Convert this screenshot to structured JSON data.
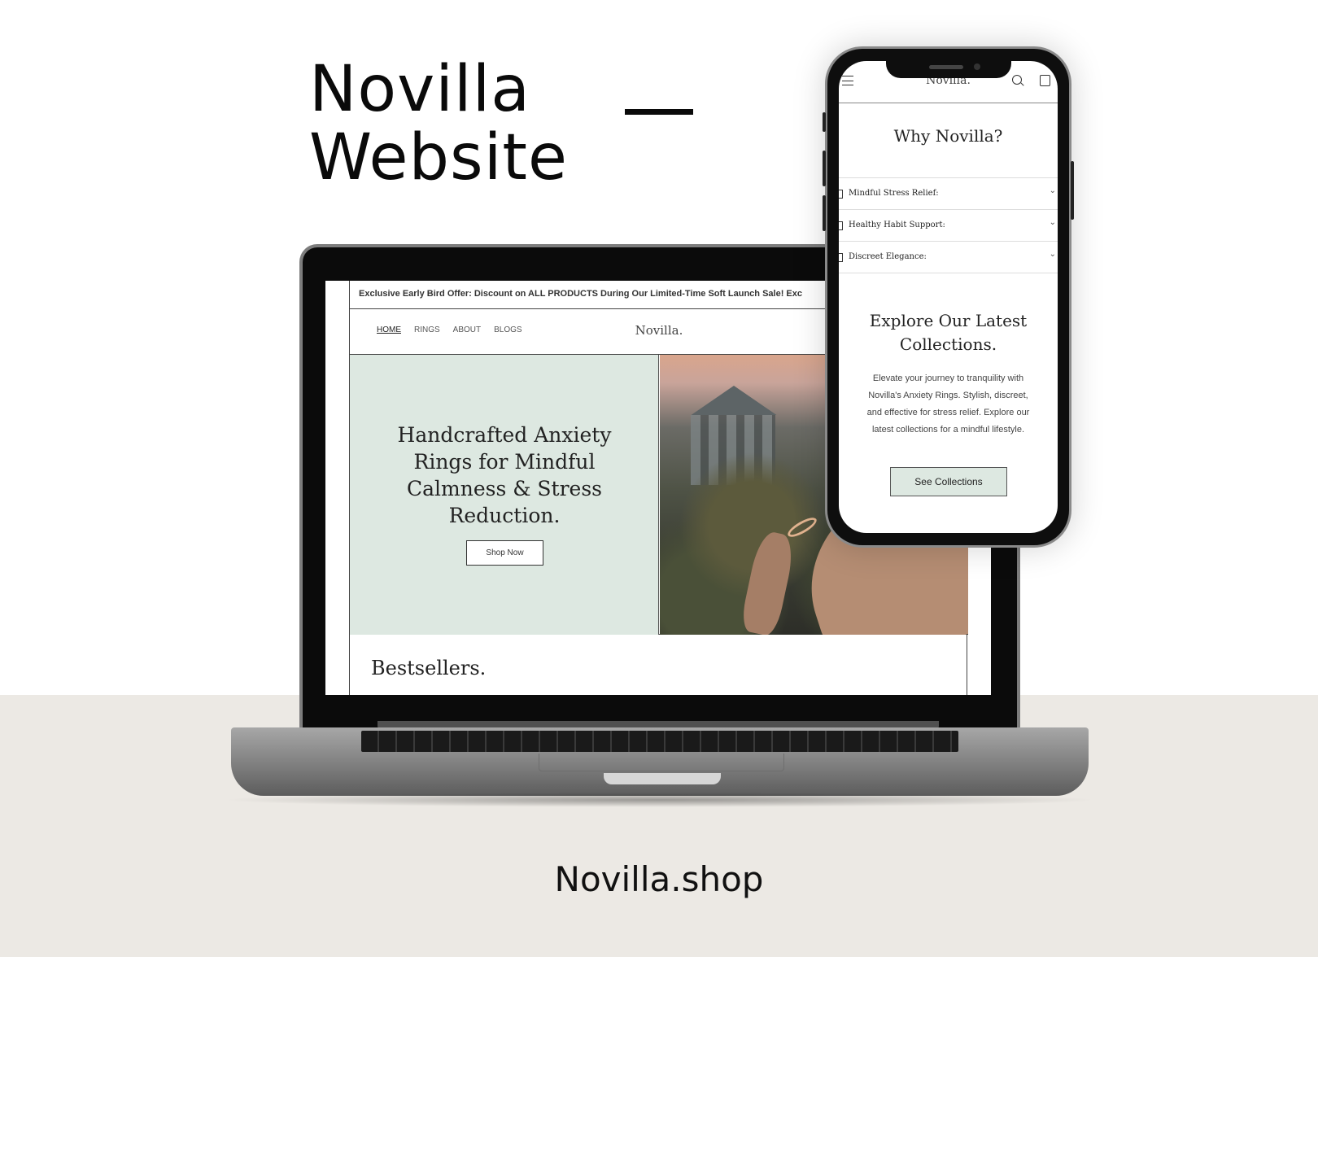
{
  "headline": {
    "line1": "Novilla",
    "line2": "Website"
  },
  "footer": {
    "url": "Novilla.shop"
  },
  "desktop_site": {
    "announcement": "Exclusive Early Bird Offer: Discount on ALL PRODUCTS During Our Limited-Time Soft Launch Sale!    Exc",
    "nav": [
      "HOME",
      "RINGS",
      "ABOUT",
      "BLOGS"
    ],
    "brand": "Novilla.",
    "hero": {
      "heading": "Handcrafted Anxiety Rings for Mindful Calmness & Stress Reduction.",
      "button": "Shop Now"
    },
    "section_title": "Bestsellers."
  },
  "mobile_site": {
    "brand": "Novilla.",
    "why_title": "Why Novilla?",
    "accordion": [
      "Mindful Stress Relief:",
      "Healthy Habit Support:",
      "Discreet Elegance:"
    ],
    "explore_title": "Explore Our Latest Collections.",
    "explore_body": "Elevate your journey to tranquility with Novilla's Anxiety Rings. Stylish, discreet, and effective for stress relief. Explore our latest collections for a mindful lifestyle.",
    "button": "See Collections"
  }
}
